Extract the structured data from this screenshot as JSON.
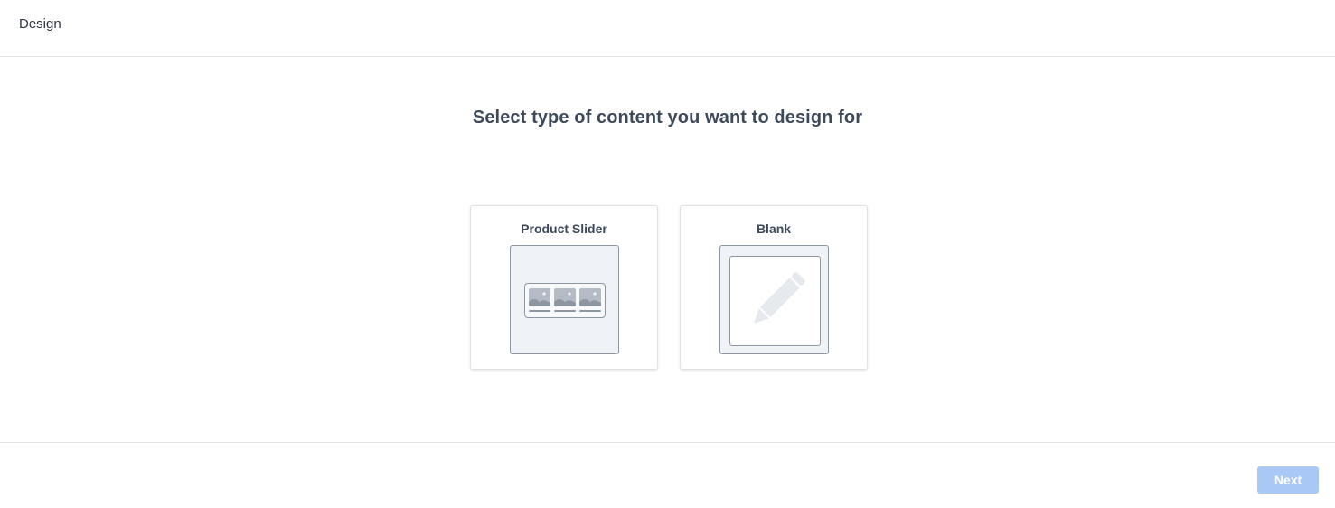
{
  "header": {
    "title": "Design"
  },
  "main": {
    "heading": "Select type of content you want to design for",
    "options": [
      {
        "label": "Product Slider",
        "icon": "product-slider-icon"
      },
      {
        "label": "Blank",
        "icon": "pencil-icon"
      }
    ]
  },
  "footer": {
    "next_label": "Next",
    "next_enabled": false
  },
  "colors": {
    "next_button_disabled": "#a9c8f6",
    "preview_background": "#eff3f8",
    "preview_border": "#8e96a1",
    "heading_text": "#3e4a59"
  }
}
